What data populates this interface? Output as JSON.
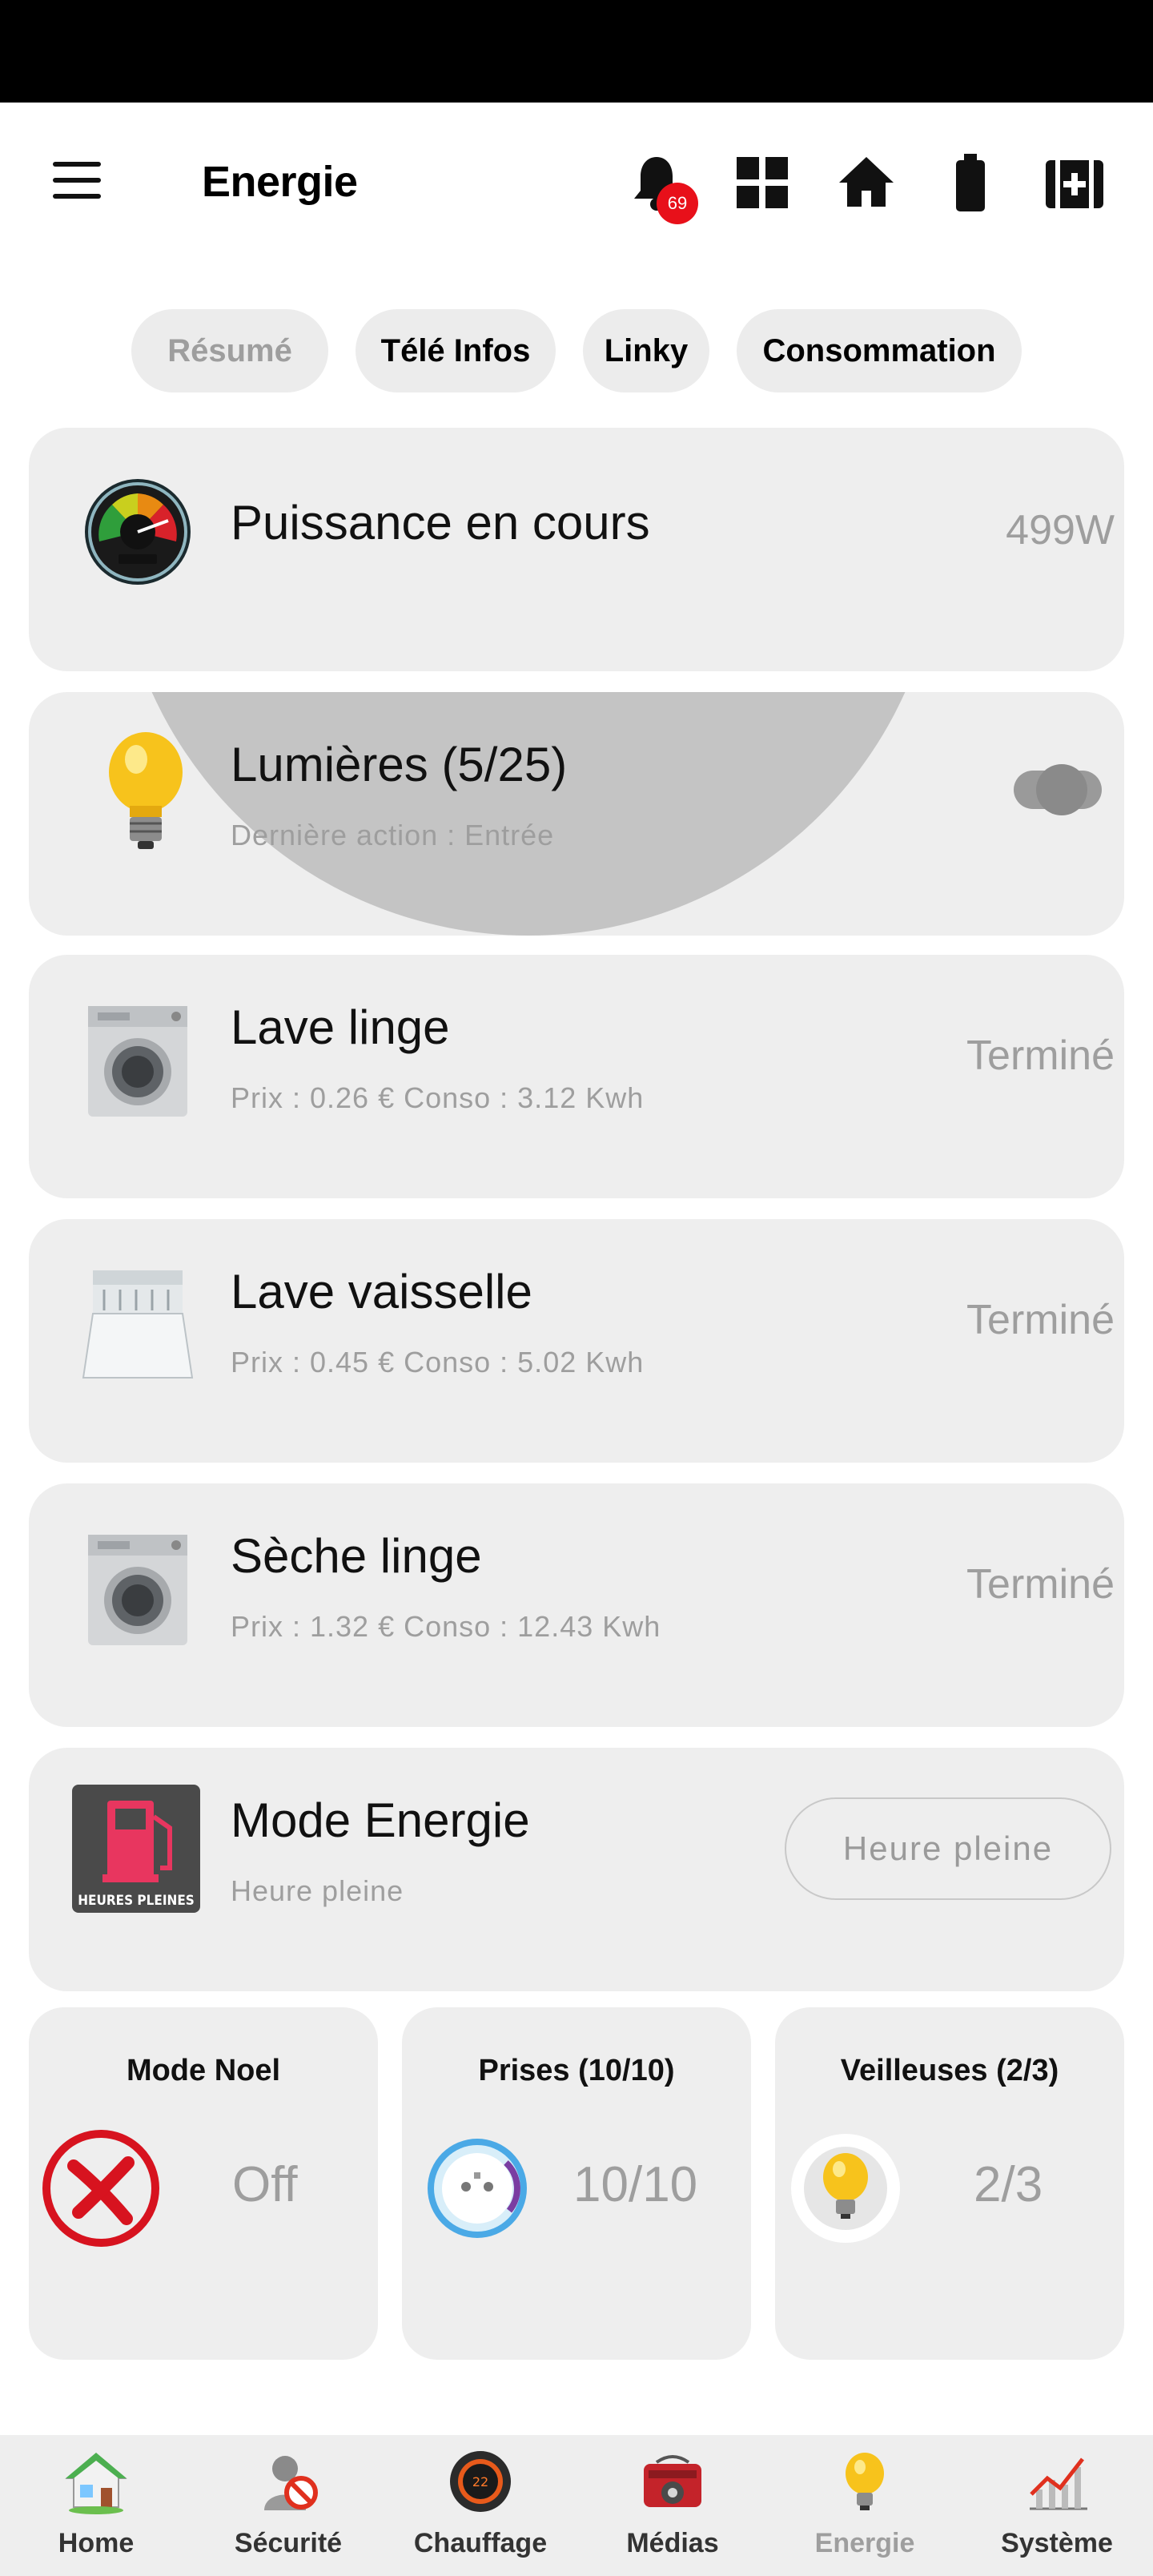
{
  "app": {
    "title": "Energie",
    "notification_count": "69",
    "top_icons": [
      "bell-icon",
      "dashboard-grid-icon",
      "home-icon",
      "battery-icon",
      "medical-kit-icon"
    ]
  },
  "tabs": [
    {
      "label": "Résumé",
      "active": true
    },
    {
      "label": "Télé Infos",
      "active": false
    },
    {
      "label": "Linky",
      "active": false
    },
    {
      "label": "Consommation",
      "active": false
    }
  ],
  "cards": {
    "power": {
      "title": "Puissance en cours",
      "value": "499W",
      "icon": "power-gauge-icon"
    },
    "lights": {
      "title": "Lumières  (5/25)",
      "subtitle": "Dernière action : Entrée",
      "icon": "light-bulb-icon",
      "toggle_on": false
    },
    "washer": {
      "title": "Lave linge",
      "subtitle": "Prix : 0.26 € Conso : 3.12 Kwh",
      "value": "Terminé",
      "icon": "washing-machine-icon"
    },
    "dishwasher": {
      "title": "Lave vaisselle",
      "subtitle": "Prix : 0.45 € Conso : 5.02 Kwh",
      "value": "Terminé",
      "icon": "dishwasher-icon"
    },
    "dryer": {
      "title": "Sèche linge",
      "subtitle": "Prix : 1.32 € Conso : 12.43 Kwh",
      "value": "Terminé",
      "icon": "dryer-icon"
    },
    "mode": {
      "title": "Mode Energie",
      "subtitle": "Heure pleine",
      "button_label": "Heure pleine",
      "icon": "heures-pleines-icon",
      "icon_text": "HEURES PLEINES"
    }
  },
  "tiles": [
    {
      "title": "Mode Noel",
      "value": "Off",
      "icon": "red-cross-icon"
    },
    {
      "title": "Prises  (10/10)",
      "value": "10/10",
      "icon": "smart-plug-icon"
    },
    {
      "title": "Veilleuses  (2/3)",
      "value": "2/3",
      "icon": "light-bulb-icon"
    }
  ],
  "bottom_nav": [
    {
      "label": "Home",
      "icon": "house-icon",
      "active": false
    },
    {
      "label": "Sécurité",
      "icon": "security-person-icon",
      "active": false
    },
    {
      "label": "Chauffage",
      "icon": "thermostat-icon",
      "active": false,
      "icon_text": "22"
    },
    {
      "label": "Médias",
      "icon": "radio-icon",
      "active": false
    },
    {
      "label": "Energie",
      "icon": "light-bulb-icon",
      "active": true
    },
    {
      "label": "Système",
      "icon": "chart-icon",
      "active": false
    }
  ],
  "colors": {
    "card_bg": "#eeeeee",
    "muted_text": "#9e9e9e",
    "badge_red": "#e8101a",
    "status_bar": "#000000"
  }
}
